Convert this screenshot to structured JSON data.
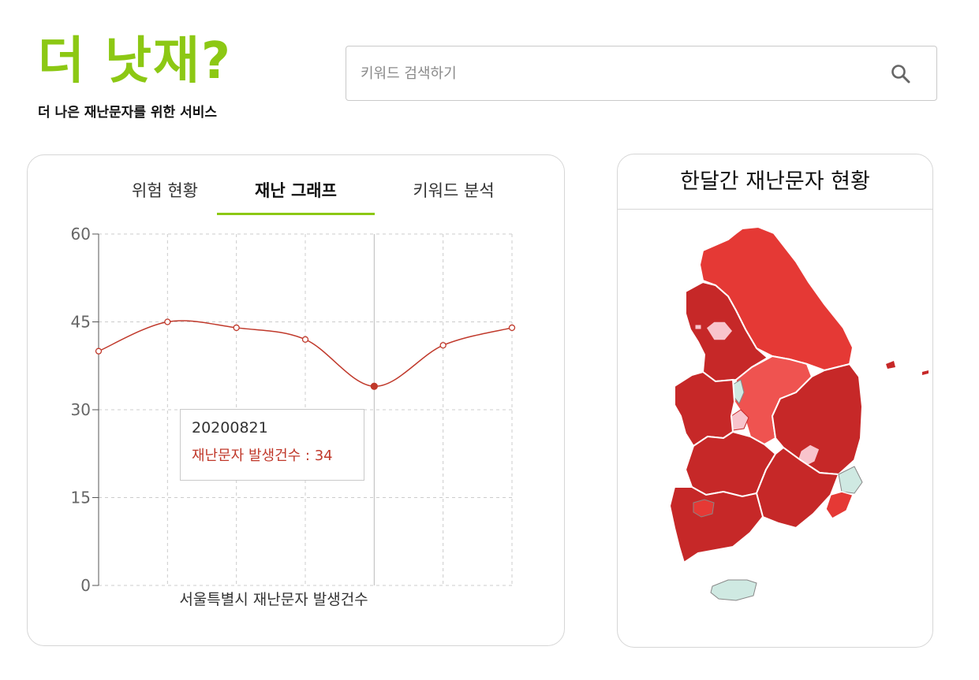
{
  "brand": {
    "title": "더 낫재?",
    "subtitle": "더 나은 재난문자를 위한 서비스",
    "color": "#8cc814"
  },
  "search": {
    "placeholder": "키워드 검색하기",
    "icon": "search-icon"
  },
  "tabs": [
    {
      "label": "위험 현황",
      "active": false
    },
    {
      "label": "재난 그래프",
      "active": true
    },
    {
      "label": "키워드 분석",
      "active": false
    }
  ],
  "chart_data": {
    "type": "line",
    "x": [
      "",
      "",
      "",
      "",
      "20200821",
      "",
      ""
    ],
    "values": [
      40,
      45,
      44,
      42,
      34,
      41,
      44
    ],
    "ylim": [
      0,
      60
    ],
    "yticks": [
      "0",
      "15",
      "30",
      "45",
      "60"
    ],
    "xlabel": "서울특별시 재난문자 발생건수",
    "ylabel": "",
    "grid": true,
    "line_color": "#c0392b",
    "highlight_index": 4
  },
  "tooltip": {
    "date": "20200821",
    "series_label": "재난문자 발생건수",
    "value": "34",
    "line": "재난문자 발생건수 : 34"
  },
  "map": {
    "title": "한달간 재난문자 현황",
    "colors": {
      "high": "#c62828",
      "mid": "#e53935",
      "low": "#ef5350",
      "lowest": "#f8c4cc",
      "none": "#cfe9e2"
    }
  }
}
